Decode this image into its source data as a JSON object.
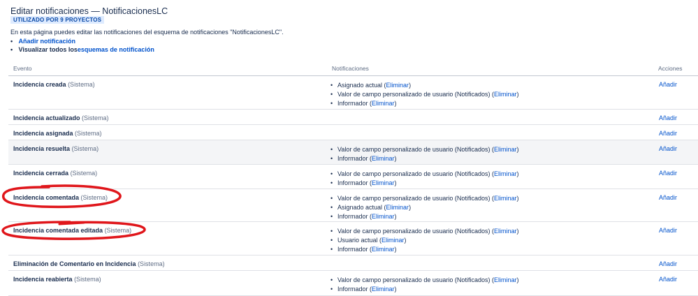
{
  "page": {
    "title": "Editar notificaciones — NotificacionesLC",
    "badge": "UTILIZADO POR 9 PROYECTOS",
    "description": "En esta página puedes editar las notificaciones del esquema de notificaciones \"NotificacionesLC\".",
    "add_notification": "Añadir notificación",
    "view_all_prefix": "Visualizar todos los",
    "view_all_link": "esquemas de notificación"
  },
  "table": {
    "columns": [
      "Evento",
      "Notificaciones",
      "Acciones"
    ],
    "rows": [
      {
        "event": "Incidencia creada",
        "tag": "(Sistema)",
        "action": "Añadir",
        "notifications": [
          {
            "text": "Asignado actual",
            "link": "Eliminar"
          },
          {
            "text": "Valor de campo personalizado de usuario (Notificados)",
            "link": "Eliminar"
          },
          {
            "text": "Informador",
            "link": "Eliminar"
          }
        ]
      },
      {
        "event": "Incidencia actualizado",
        "tag": "(Sistema)",
        "action": "Añadir",
        "notifications": []
      },
      {
        "event": "Incidencia asignada",
        "tag": "(Sistema)",
        "action": "Añadir",
        "notifications": []
      },
      {
        "event": "Incidencia resuelta",
        "tag": "(Sistema)",
        "action": "Añadir",
        "notifications": [
          {
            "text": "Valor de campo personalizado de usuario (Notificados)",
            "link": "Eliminar"
          },
          {
            "text": "Informador",
            "link": "Eliminar"
          }
        ]
      },
      {
        "event": "Incidencia cerrada",
        "tag": "(Sistema)",
        "action": "Añadir",
        "notifications": [
          {
            "text": "Valor de campo personalizado de usuario (Notificados)",
            "link": "Eliminar"
          },
          {
            "text": "Informador",
            "link": "Eliminar"
          }
        ]
      },
      {
        "event": "Incidencia comentada",
        "tag": "(Sistema)",
        "action": "Añadir",
        "notifications": [
          {
            "text": "Valor de campo personalizado de usuario (Notificados)",
            "link": "Eliminar"
          },
          {
            "text": "Asignado actual",
            "link": "Eliminar"
          },
          {
            "text": "Informador",
            "link": "Eliminar"
          }
        ]
      },
      {
        "event": "Incidencia comentada editada",
        "tag": "(Sistema)",
        "action": "Añadir",
        "notifications": [
          {
            "text": "Valor de campo personalizado de usuario (Notificados)",
            "link": "Eliminar"
          },
          {
            "text": "Usuario actual",
            "link": "Eliminar"
          },
          {
            "text": "Informador",
            "link": "Eliminar"
          }
        ]
      },
      {
        "event": "Eliminación de Comentario en Incidencia",
        "tag": "(Sistema)",
        "action": "Añadir",
        "notifications": []
      },
      {
        "event": "Incidencia reabierta",
        "tag": "(Sistema)",
        "action": "Añadir",
        "notifications": [
          {
            "text": "Valor de campo personalizado de usuario (Notificados)",
            "link": "Eliminar"
          },
          {
            "text": "Informador",
            "link": "Eliminar"
          }
        ]
      }
    ]
  },
  "colors": {
    "link": "#0052cc",
    "highlight_row": "#f4f5f7",
    "annotation": "#e0161b"
  }
}
